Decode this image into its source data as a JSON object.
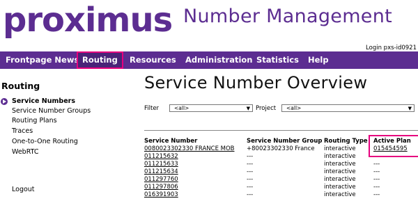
{
  "header": {
    "logo_text": "proximus",
    "app_title": "Number Management",
    "login_text": "Login pxs-id0921"
  },
  "nav": {
    "items": [
      {
        "label": "Frontpage News"
      },
      {
        "label": "Routing"
      },
      {
        "label": "Resources"
      },
      {
        "label": "Administration"
      },
      {
        "label": "Statistics"
      },
      {
        "label": "Help"
      }
    ],
    "active_item": "Routing",
    "accent_color": "#5c2d91",
    "highlight_color": "#e6007e"
  },
  "sidebar": {
    "title": "Routing",
    "items": [
      {
        "label": "Service Numbers"
      },
      {
        "label": "Service Number Groups"
      },
      {
        "label": "Routing Plans"
      },
      {
        "label": "Traces"
      },
      {
        "label": "One-to-One Routing"
      },
      {
        "label": "WebRTC"
      }
    ],
    "active_item": "Service Numbers",
    "logout_label": "Logout"
  },
  "main": {
    "title": "Service Number Overview",
    "filter_label": "Filter",
    "filter_value": "<all>",
    "project_label": "Project",
    "project_value": "<all>",
    "table": {
      "headers": [
        "Service Number",
        "Service Number Group",
        "Routing Type",
        "Active Plan"
      ],
      "rows": [
        {
          "number": "0080023302330 FRANCE MOB",
          "group": "+80023302330 France",
          "type": "interactive",
          "plan": "015454595"
        },
        {
          "number": "011215632",
          "group": "---",
          "type": "interactive",
          "plan": ""
        },
        {
          "number": "011215633",
          "group": "---",
          "type": "interactive",
          "plan": "---"
        },
        {
          "number": "011215634",
          "group": "---",
          "type": "interactive",
          "plan": "---"
        },
        {
          "number": "011297760",
          "group": "---",
          "type": "interactive",
          "plan": "---"
        },
        {
          "number": "011297806",
          "group": "---",
          "type": "interactive",
          "plan": "---"
        },
        {
          "number": "016391903",
          "group": "---",
          "type": "interactive",
          "plan": "---"
        }
      ]
    }
  }
}
